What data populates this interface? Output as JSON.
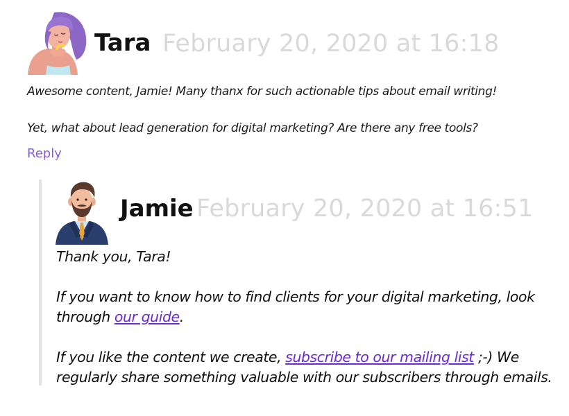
{
  "comments": [
    {
      "author": "Tara",
      "date": "February 20, 2020 at 16:18",
      "avatar": "woman-avatar-icon",
      "paragraphs": [
        "Awesome content, Jamie! Many thanx for such actionable tips about email writing!",
        "Yet, what about lead generation for digital marketing? Are there any free tools?"
      ],
      "reply_label": "Reply",
      "replies": [
        {
          "author": "Jamie",
          "date": "February 20, 2020 at 16:51",
          "avatar": "bearded-man-avatar-icon",
          "p1": "Thank you, Tara!",
          "p2_line1": "If you want to know how to find clients for your digital marketing, look",
          "p2_prefix": "through ",
          "p2_link": "our guide",
          "p2_suffix": ".",
          "p3_prefix": "If you like the content we create, ",
          "p3_link": "subscribe to our mailing list",
          "p3_suffix": " ;-) We",
          "p3_line2": "regularly share something valuable with our subscribers through emails."
        }
      ]
    }
  ],
  "colors": {
    "date": "#d9d9d9",
    "reply_link": "#8a5cd6",
    "inline_link": "#6a2ad8",
    "thread_bar": "#e3e3e3"
  }
}
